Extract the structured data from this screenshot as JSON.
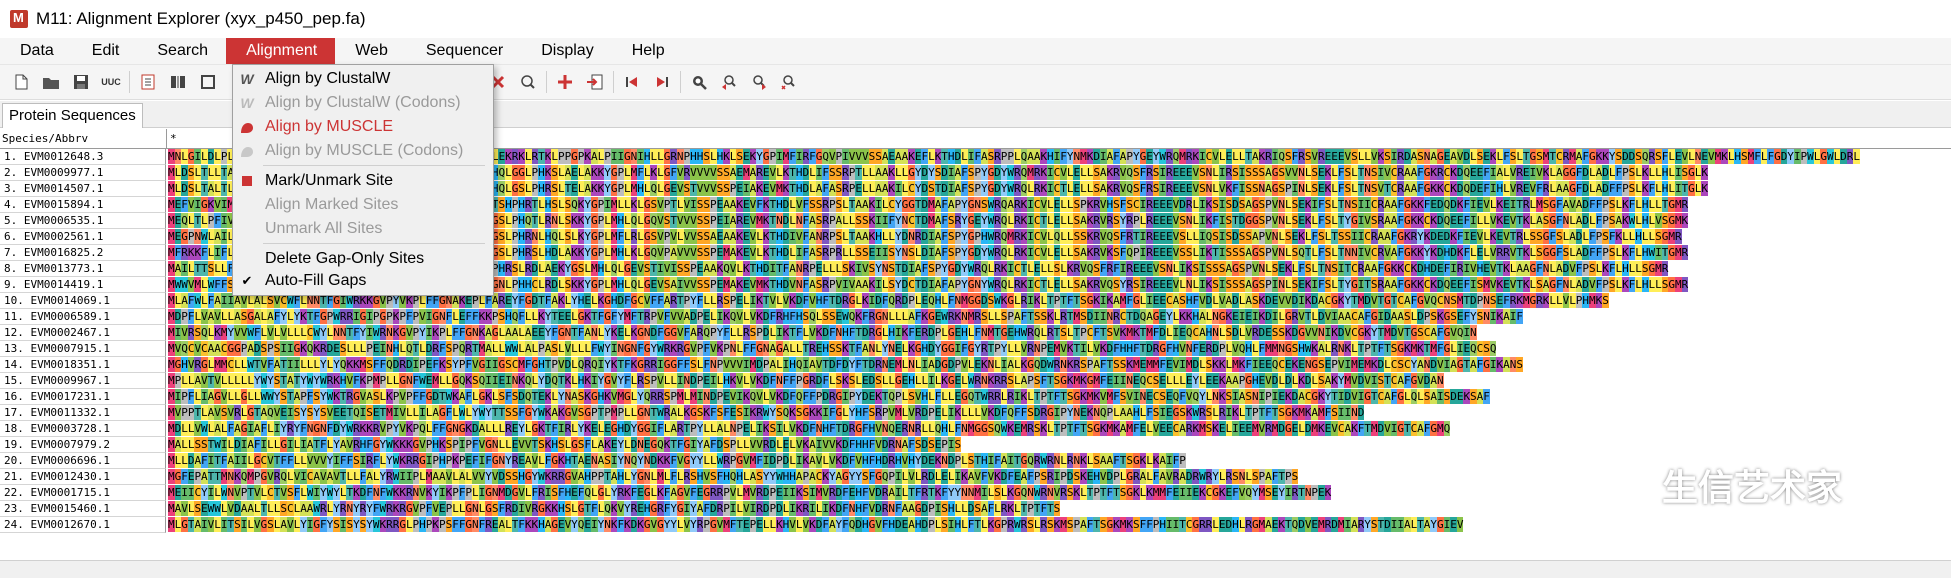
{
  "window": {
    "title": "M11: Alignment Explorer (xyx_p450_pep.fa)"
  },
  "menubar": {
    "items": [
      "Data",
      "Edit",
      "Search",
      "Alignment",
      "Web",
      "Sequencer",
      "Display",
      "Help"
    ],
    "active_index": 3
  },
  "toolbar": {
    "icons": [
      "new-file-icon",
      "open-folder-icon",
      "save-icon",
      "case-toggle-icon",
      "notes-icon",
      "columns-icon",
      "tools-icon",
      "cut-icon",
      "copy-icon",
      "delete-icon",
      "gap-icon",
      "insert-icon",
      "import-icon",
      "prev-icon",
      "next-icon",
      "search-icon",
      "search-prev-icon",
      "search-next-icon",
      "search-clear-icon"
    ],
    "case_label": "UUC"
  },
  "tabs": {
    "active_label": "Protein Sequences"
  },
  "alignment_menu": {
    "items": [
      {
        "label": "Align by ClustalW",
        "icon": "W",
        "disabled": false,
        "highlight": false
      },
      {
        "label": "Align by ClustalW (Codons)",
        "icon": "W",
        "disabled": true,
        "highlight": false
      },
      {
        "label": "Align by MUSCLE",
        "icon": "arm-icon",
        "disabled": false,
        "highlight": true
      },
      {
        "label": "Align by MUSCLE (Codons)",
        "icon": "arm-icon",
        "disabled": true,
        "highlight": false
      },
      {
        "label": "Mark/Unmark Site",
        "icon": "mark-icon",
        "disabled": false,
        "highlight": false
      },
      {
        "label": "Align Marked Sites",
        "icon": "",
        "disabled": true,
        "highlight": false
      },
      {
        "label": "Unmark All Sites",
        "icon": "",
        "disabled": true,
        "highlight": false
      },
      {
        "label": "Delete Gap-Only Sites",
        "icon": "",
        "disabled": false,
        "highlight": false
      },
      {
        "label": "Auto-Fill Gaps",
        "icon": "check-icon",
        "disabled": false,
        "highlight": false
      }
    ]
  },
  "grid": {
    "header_name": "Species/Abbrv",
    "header_marker": "*",
    "rows": [
      {
        "name": "1.  EVM0012648.3",
        "seq": "MNLGILDLPLKYIPNHQLHIIHPIYFLDLSFPLTALILSKSIHLYFGLSLEKRKLRTKLPPGPKALPIIGNIHLLGRNPHHSLHKLSEKYGPIMFIRFGQVPIVVVSSAEAAKEFLKTHDLIFASRPPLQAAKHIFYNMKDIAFAPYGEYWRQMRKICVLELLTAKRIQSFRSVREEEVSLLVKSIRDASNAGEAVDLSEKLFSLTGSMTCRMAFGKKYSDDSQRSFLEVLNEVMKLHSMFLFGDYIPWLGWLDRL"
      },
      {
        "name": "2.  EVM0009977.1",
        "seq": "MLDSLTLLTATLTLSLLVLVLLWKLRGKVSNGGMKLPPGPWALPIIGNLHQLGGLPHKSLAELAKKYGPLMFLKLGFVRVVVVSSAEMAREVLKTHDLIFSSRPTLLAAKLLGYDYSDIAFSPYGDYWRQMRKICVLELLSAKRVQSFRSIREEEVSNLIRSISSSAGSVVNLSEKLFSLTNSIVCRAAFGKRCKDQEEFIALVREIVKLAGGFDLADLFPSLKLLHLISGLK"
      },
      {
        "name": "3.  EVM0014507.1",
        "seq": "MLDSLTALTLSLLLLAFSLYLLSKYFFTSKKKPSNLPPGPWKLPIIGNLHQLGSLPHRSLTELAKKYGPLMHLQLGEVSTVVVSSPEIAKEVMKTHDLAFASRPELLAAKILCYDSTDIAFSPYGDYWRQLRKICTLELLSAKRVQSFRSIREEEVSNLVKFISSNAGSPINLSEKLFSLTNSVTCRAAFGKKCKDQDEFIHLVREVFRLAAGFDLADFFPSLKFLHLITGLK"
      },
      {
        "name": "4.  EVM0015894.1",
        "seq": "MEFVIGKVIMVALLVLLTLLFQNIHKSRKPNLPPGPRPWPLIGNLHQLGTSHPHRTLHSLSQKYGPIMLLKLGSVPTLVISSPEAAKEVFKTHDLVFSSRPSLTAAKILCYGGTDMAFAPYGNSWRQARKICVLELLSPKRVHSFSCIREEEVDRLIKSISDSAGSPVNLSEKIFSLTNSIICRAAFGKKFEDQDKFIEVLKEITRLMSGFAVADFFPSLKFLHLLTGMR"
      },
      {
        "name": "5.  EVM0006535.1",
        "seq": "MEQLTLPFIVILLLSLFFLLHHHHKSKSKPNLPPSPPKLPFIGNLHQLAGSLPHQTLRNLSKKYGPLMHLQLGQVSTVVVSSPEIAREVMKTNDLNFASRPALLSSKIIFYNCTDMAFSRYGEYWRQLRKICTLELLSAKRVRSYRPLREEEVSNLIKFISTDGGSPVNLSEKLFSLTYGIVSRAAFGKKCKDQEEFILLVKEVTKLASGFNLADLFPSAKWLHLVSGMK"
      },
      {
        "name": "6.  EVM0002561.1",
        "seq": "MEGPNWLAILVAILLIVSLFFLYSRKRQLSLKLPPGPPALPIIGNLHLLGSLPHRNLHQLSLKYGPLMFLRLGSVPVLVVSSAEAAKEVLKTHDIVFANRPSLTAAKHLLYDNRDIAFSPYGPHWRQMRKICVLQLLSSKRVQSFRTIREEEVSLLIQSISDSSAPVNLSEKLFSLTSSIICRAAFGKRYKDEDKFIEVLKEVTRLSSGFSLADLFPSFKLLHLLSGMR"
      },
      {
        "name": "7.  EVM0016825.2",
        "seq": "MFRKKFLIFLILLSFPLAIIFLLRQNRKNSVKLPPGPPRLPIIGNLHQLGSLPHRSLHDLAKKYGPLMHLKLGQVPAVVVSSPEMAKEVLKTHDLIFASRPRLLSSEIISYNSLDIAFSPYGDYWRQLRKICVLELLSAKRVKSFQPIREEEVSSLIKTISSSAGSPVNLSQTLFSLTNNIVCRVAFGKKYKDHDKFLELVRRVTKLSGGFSLADFFPSLKFLHWITGMR"
      },
      {
        "name": "8.  EVM0013773.1",
        "seq": "MAILTTSLLFSLTLLLLLLLFNRLKNGKKLPPGPWRLPVIGNMHQLGSLPHRSLRDLAEKYGSLMHLQLGEVSTIVISSPEAAKQVLKTHDITFANRPELLLSKIVSYNSTDIAFSPYGDYWRQLRKICTLELLSLKRVQSFRFIREEEVSNLIKSISSSAGSPVNLSEKLFSLTNSITCRAAFGKKCKDHDEFIRIVHEVTKLAAGFNLADVFPSLKFLHLLSGMR"
      },
      {
        "name": "9.  EVM0014419.1",
        "seq": "MWWVMLWFFSLFFLLAIAVLLLKQNKRKSRKLPPGPWKLPLIGNLHQLAGNLPHHCLRDLSKKYGPLMHLQLGEVSAIVVSSPEMAKEVMKTHDVNFASRPVIVAAKILSYDCTDIAFAPYGNYWRQLRKICTLELLSAKRVQSYRSIREEEVLNLIKSISSSAGSPINLSEKIFSLTYGITSRAAFGKKCKDQEEFISMVKEVTKLSAGFNLADVFPSLKFLHLLSGMR"
      },
      {
        "name": "10. EVM0014069.1",
        "seq": "MLAFWLFAIIAVLALSVCWFLNNTFGIWRKKGVPYVKPLFFGNAKEPLFAREYFGDTFAKLYHELKGHDFGCVFFARTPYFLLRSPELIKTVLVKDFVHFTDRGLKIDFQRDPLEQHLFNMGGDSWKGLRIKLTPTFTSGKIKAMFGLIEECASHFVDLVADLASKDEVVDIKDACGKYTMDVTGTCAFGVQCNSMTDPNSEFRKMGRKLLVLPHMKS"
      },
      {
        "name": "11. EVM0006589.1",
        "seq": "MDPFLVAVLLASGALAFYLYKTFGPWRRIGIPGPKPFPVIGNFLEFFKKPSHQFLLKYTEELGKTFGFYMFTRPVFVVADPELIKQVLVKDFRHFHSQLSSEWQKFRGNLLLAFKGEWRKNMRSLLSPAFTSSKLRTMSDIINRCTDQAGEYLKKHALNGKEIEIKDILGRVTLDVIAACAFGIDAASLDPSKGSEFYSNIKAIF"
      },
      {
        "name": "12. EVM0002467.1",
        "seq": "MIVRSQLKMYVVWFLVLVLLLCWYLNNTFYIWRNKGVPYIKPLFFGNKAGLAALAEEYFGNTFANLYKELKGNDFGGVFARQPYFLLRSPDLIKTFLVKDFNHFTDRGLHIKFERDPLGEHLFNMTGEHWRQLRTSLTPCFTSVKMKTMFDLIEQCAHNLSDLVRDESSKDGVVNIKDVCGKYTMDVTGSCAFGVQIN"
      },
      {
        "name": "13. EVM0007915.1",
        "seq": "MVQCVCAACGGPADSPSIIGKQKRDESLLLPEINHLQTLDRFSPQRTMALLWWLALPASLVLLLFWYINGNFGYWRKRGVPFVKPNLFFGNAGALLTREHSSKTFANLYNELKGHDYGGIFGYRTPYLLVRNPEMVKTILVKDFHHFTDRGFHVNFERDPLVQHLFMMNGSHWKALRNKLTPTFTSGKMKTMFGLIEQCSQ"
      },
      {
        "name": "14. EVM0018351.1",
        "seq": "MGHVRGLMMCLLWTVFATIILLLYLYQKKMSFFQDRDIPEFKSYPFVGIIGSCMFGHTPVDLQRQIYKTFKGRRIGGFFSLFNPVVVIMDPALIHQIAVTDFDYFTDRNEMLNLIADGDPVLEKNLIALKGQDWRNKRSPAFTSSKMEMMFEVIMDLSKKLMKFIEEQCEKENGSEPVIMEMKDLCSCYANDVIAGTAFGIKANS"
      },
      {
        "name": "15. EVM0009967.1",
        "seq": "MPLLAVTVLLLLLYWYSTATYWYWRKHVFKPMPLLGNFWEMLLGQKSQIIEINKQLYDQTKLHKIYGVYFLRSPVLLINDPEILHKVLVKDFNFFPGRDFLSKSLEDSLLGEHLLILKGELWRNKRRSLAPSFTSGKMKGMFEIINEQCSELLLEYLEEKAAPGHEVDLDLKDLSAKYMVDVISTCAFGVDAN"
      },
      {
        "name": "16. EVM0017231.1",
        "seq": "MIPFLIAGVLLGLLWWYSTAPFSYWKTRGVASLKPVPFFGDTWKAFLGKLSFSDQTEKLYNASKGHKVMGLYQRRSPMLMINDPEVIKQVLVKDFQFFPDRGIPYDEKTQPLSVHLFLLEGQTWRRLRIKLTPTFTSGKMKVMFSVINECSEQFVQYLNKSIASNIPIEKDACGKYTIDVIGTCAFGLQLSAISDEKSAF"
      },
      {
        "name": "17. EVM0011332.1",
        "seq": "MVPPTLAVSVRLGTAQVEISYSYSVEETQISETMIVLLILAGFLWLYWYTTSSFGYWKAKGVSGPTPMPLLGNTWRALKGSKFSFESIKRWYSQKSGKKIFGLYHFSRPVMLVRDPELIKLLLVKDFQFFSDRGIPYNEKNQPLAAHLFSIEGSKWRSLRIKLTPTFTSGKMKAMFSIIND"
      },
      {
        "name": "18. EVM0003728.1",
        "seq": "MDLLVWLALFAGIAFLIYRYFNGNFDYWRKKRVPYVKPQLFFGNGKDALLLREYLGKTFIRLYKELEGHDYGGIFLARTPYLLALNPELIKSILVKDFNHFTDRGFHVNQERNRLLQHLFNMGGSQWKEMRSKLTPTFTSGKMKAMFELVEECARKMSKELIEEMVRMDGELDMKEVCAKFTMDVIGTCAFGMQ"
      },
      {
        "name": "19. EVM0007979.2",
        "seq": "MALLSSTWILDIAFILLGILIATFLYAVRHFGYWKKKGVPHKSPIPFVGNLLEVVTSKHSLGSFLAKEYLDNEGQKTFGIYAFDSPLLVVRDLELVKAIVVKDFHHFVDRNAFSDSEPIS"
      },
      {
        "name": "20. EVM0006696.1",
        "seq": "MLLDAFITFAIILGCVTFFLLVVVYIFFSIRFLYWKRRGIPHPKPEFIFGNYREAVLFGKHTAENASIYNQYNDKKFVGYYLLWRPGVMFIDPDLIKAVLVKDFVHFHDRHVHYDEKNDPLSTHIFAITGQRWRNLRNKLSAAFTSGKLKAIFP"
      },
      {
        "name": "21. EVM0012430.1",
        "seq": "MGFEPATTMNKQMPGVRQLVICAVAVTLLFALYRWIIPLMAAVLALVVYVDSSHGYWKRRGVAHPPTAHLYGNLMLFLRSHVSFHQHLASYYWHHAPACKYAGYYSFGQPILVLRDLELIKAVFVKDFEAFPSRIPDSKEHVDPLGRALFAVRADRWRYLRSNLSPAFTPS"
      },
      {
        "name": "22. EVM0001715.1",
        "seq": "MEIICYILWNVPTVLCTVSFLWIYWYLTKDFNFWKKRNVKYIKPFPLIGNMDGVLFRISFHEFQLGLYRKFEGLKFAGVFEGRRPVLMVRDPEIIKSIMVRDFEHFVDRAILTFRTKFYYNNMILSLKGQNWRNVRSKLTPTFTSGKLKMMFEIIEKCGKEFVQYMSEYIRTNPEK"
      },
      {
        "name": "23. EVM0015460.1",
        "seq": "MAVLSEWWLVDAALTLLSCLAAWRLYRNYRYFWRKRGVPFVEPLLGNLGSFRDIVRGKKHSLGTFLQKVYREHGRFYGIYAFDRPILVIRDPDLIKRILIKDFNHFVDRNFAAGDPISHLLDSAFLRKLTPTFTS"
      },
      {
        "name": "24. EVM0012670.1",
        "seq": "MLGTAIVLITSILVGSLAVLYIGFYSISYSYWKRRGLPHPKPSFFGNFREALTFKKHAGEVYQEIYNKFKDKGVGYYLVYRPGVMFTEPELLKHVLVKDFAYFQDHGVFHDEAHDPLSIHLFTLKGPRWRSLRSKMSPAFTSGKMKSFFPHIITCGRRLEDHLRGMAEKTQDVEMRDMIARYSTDIIALTAYGIEV"
      }
    ]
  },
  "colors": {
    "menu_active": "#cc3434",
    "aa": {
      "A": "#d4e157",
      "C": "#fbc02d",
      "D": "#26a69a",
      "E": "#26a69a",
      "F": "#42a5f5",
      "G": "#ff7043",
      "H": "#29b6f6",
      "I": "#66bb6a",
      "K": "#ab47bc",
      "L": "#ffee58",
      "M": "#ec407a",
      "N": "#ff8a65",
      "P": "#bdbdbd",
      "Q": "#9ccc65",
      "R": "#7e57c2",
      "S": "#ffa726",
      "T": "#4db6ac",
      "V": "#8bc34a",
      "W": "#26c6da",
      "Y": "#90caf9"
    }
  },
  "watermark": {
    "text": "生信艺术家"
  }
}
